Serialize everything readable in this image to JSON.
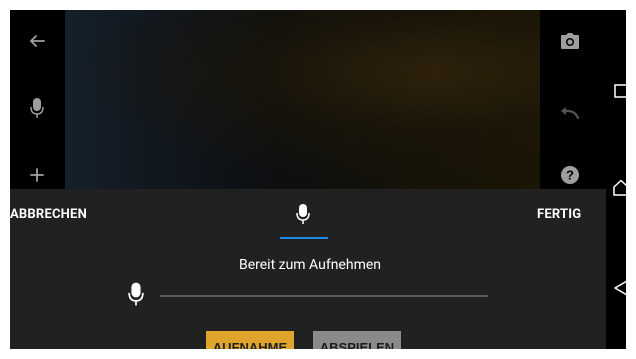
{
  "camera": {
    "left_tools": [
      {
        "name": "back-arrow-icon"
      },
      {
        "name": "microphone-icon"
      },
      {
        "name": "add-icon"
      }
    ],
    "right_tools": [
      {
        "name": "camera-icon"
      },
      {
        "name": "undo-icon"
      },
      {
        "name": "help-icon"
      }
    ]
  },
  "navigation_bar": {
    "buttons": [
      "recent-apps-icon",
      "home-icon",
      "back-icon"
    ]
  },
  "audio_panel": {
    "cancel_label": "ABBRECHEN",
    "done_label": "FERTIG",
    "active_tab_icon": "microphone-icon",
    "status": "Bereit zum Aufnehmen",
    "record_label": "AUFNAHME",
    "play_label": "ABSPIELEN"
  },
  "colors": {
    "panel_bg": "#212121",
    "accent_tab": "#1e88e5",
    "record_button": "#e0a32c",
    "play_button": "#8a8a8a"
  }
}
